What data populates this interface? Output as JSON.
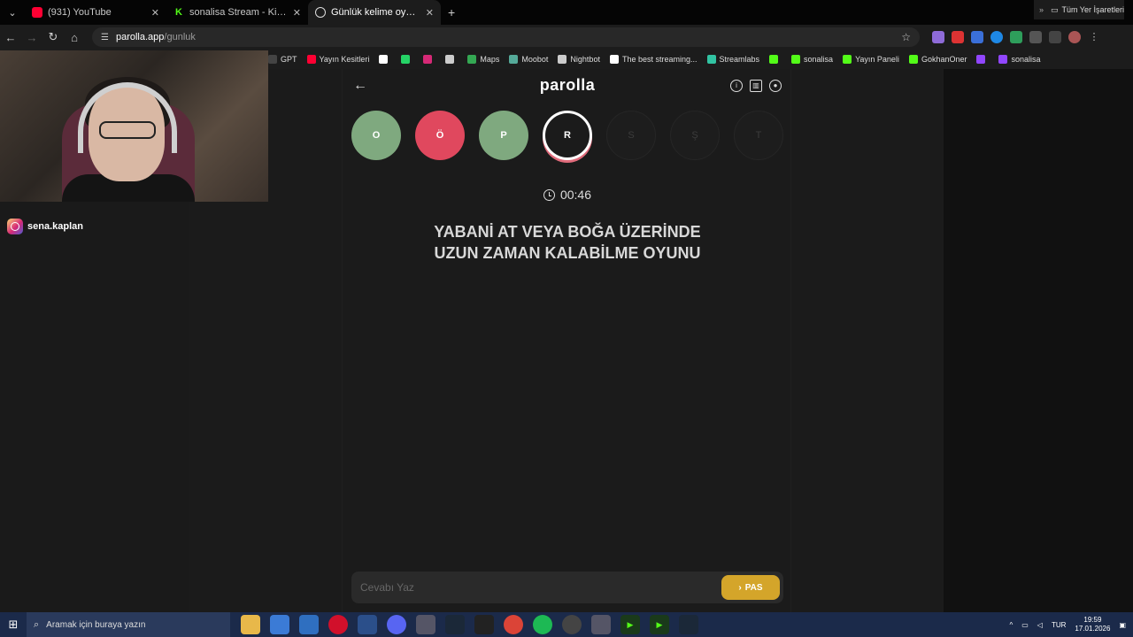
{
  "browser": {
    "tabs": [
      {
        "title": "(931) YouTube",
        "icon": "youtube-icon",
        "active": false
      },
      {
        "title": "sonalisa Stream - Kick Dashboa",
        "icon": "kick-icon",
        "active": false
      },
      {
        "title": "Günlük kelime oyunu - paro",
        "icon": "globe-icon",
        "active": true
      }
    ],
    "address": {
      "site": "parolla.app",
      "path": "/gunluk"
    },
    "bookmarks": [
      {
        "label": "GPT",
        "color": "#444444"
      },
      {
        "label": "Yayın Kesitleri",
        "color": "#ff0033"
      },
      {
        "label": "",
        "color": "#ffffff"
      },
      {
        "label": "",
        "color": "#25d366"
      },
      {
        "label": "",
        "color": "#d62976"
      },
      {
        "label": "",
        "color": "#cccccc"
      },
      {
        "label": "Maps",
        "color": "#34a853"
      },
      {
        "label": "Moobot",
        "color": "#5a9"
      },
      {
        "label": "Nightbot",
        "color": "#cccccc"
      },
      {
        "label": "The best streaming...",
        "color": "#ffffff"
      },
      {
        "label": "Streamlabs",
        "color": "#31c3a2"
      },
      {
        "label": "",
        "color": "#53fc18"
      },
      {
        "label": "sonalisa",
        "color": "#53fc18"
      },
      {
        "label": "Yayın Paneli",
        "color": "#53fc18"
      },
      {
        "label": "GokhanOner",
        "color": "#53fc18"
      },
      {
        "label": "",
        "color": "#9146ff"
      },
      {
        "label": "sonalisa",
        "color": "#9146ff"
      }
    ],
    "bookmarks_all": "Tüm Yer İşaretleri"
  },
  "overlay": {
    "instagram_handle": "sena.kaplan"
  },
  "game": {
    "logo": "parolla",
    "letters": [
      {
        "char": "O",
        "state": "correct"
      },
      {
        "char": "Ö",
        "state": "wrong"
      },
      {
        "char": "P",
        "state": "correct"
      },
      {
        "char": "R",
        "state": "current"
      },
      {
        "char": "S",
        "state": "pending"
      },
      {
        "char": "Ş",
        "state": "pending"
      },
      {
        "char": "T",
        "state": "pending"
      }
    ],
    "timer": "00:46",
    "question_line1": "YABANİ AT VEYA BOĞA ÜZERİNDE",
    "question_line2": "UZUN ZAMAN KALABİLME OYUNU",
    "answer_placeholder": "Cevabı Yaz",
    "pass_label": "PAS"
  },
  "taskbar": {
    "search_placeholder": "Aramak için buraya yazın",
    "lang": "TUR",
    "time": "19:59",
    "date": "17.01.2026"
  },
  "colors": {
    "correct": "#7fa97f",
    "wrong": "#e0485e",
    "pass_button": "#d4a52a"
  }
}
